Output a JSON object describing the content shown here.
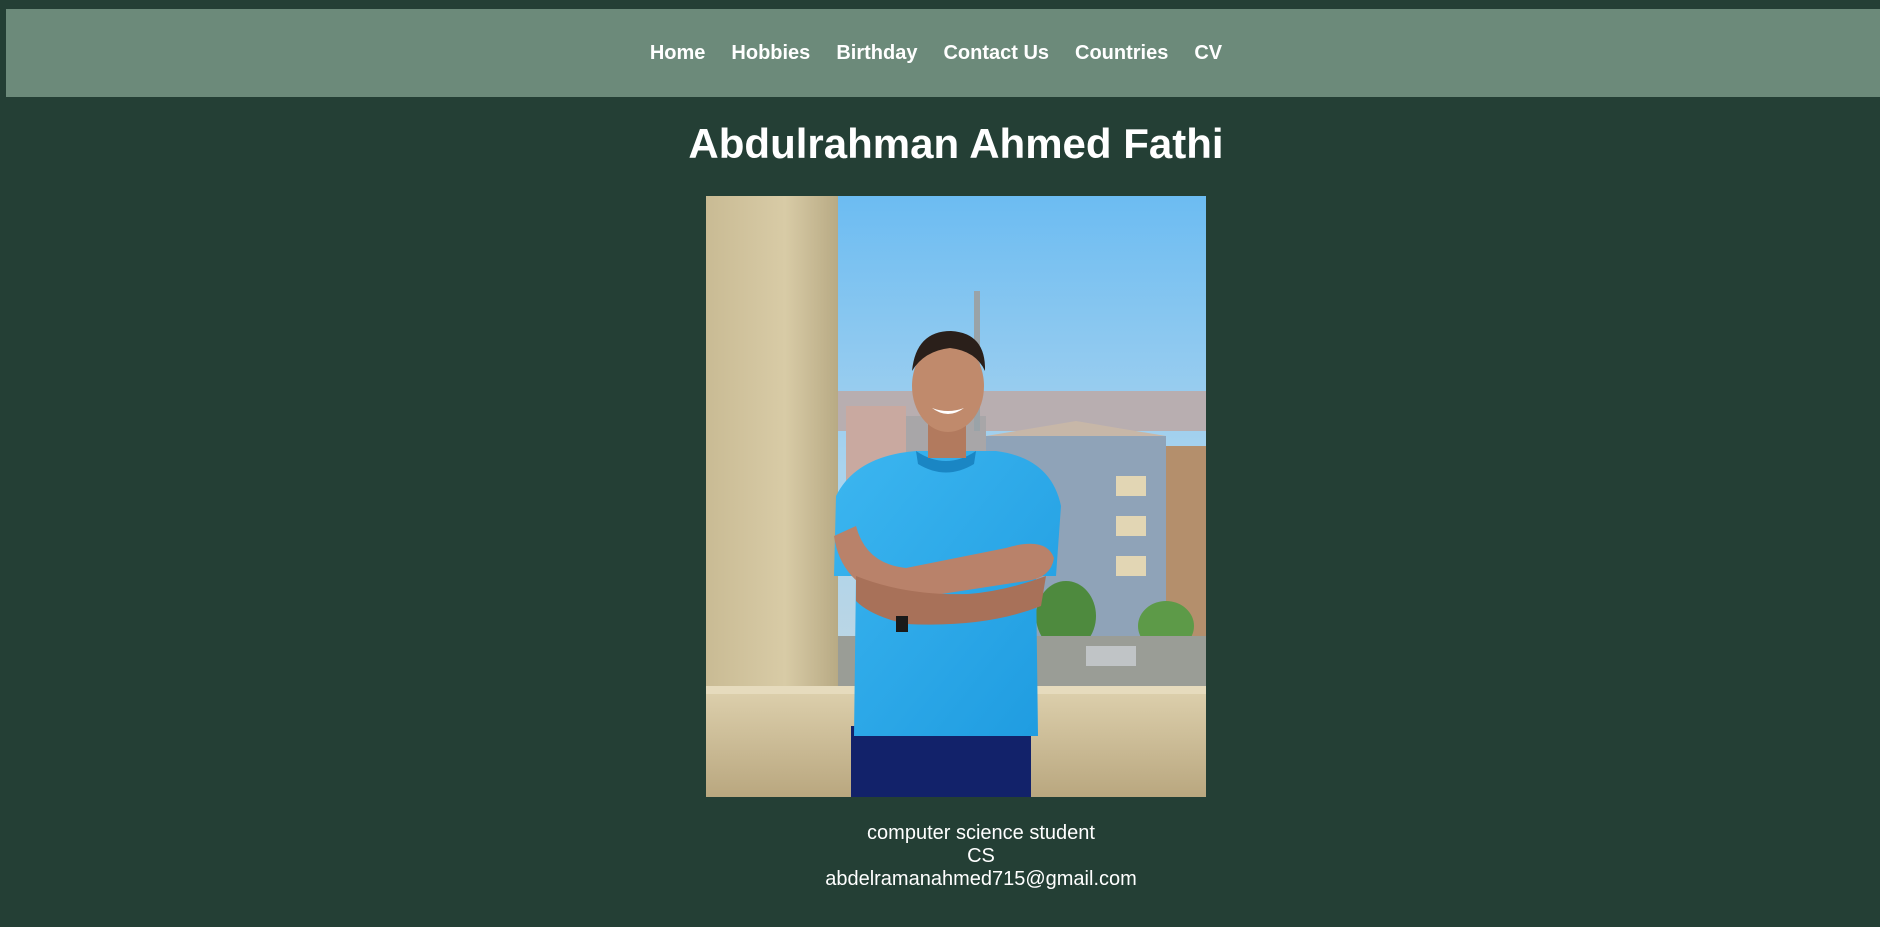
{
  "nav": {
    "items": [
      {
        "label": "Home"
      },
      {
        "label": "Hobbies"
      },
      {
        "label": "Birthday"
      },
      {
        "label": "Contact Us"
      },
      {
        "label": "Countries"
      },
      {
        "label": "CV"
      }
    ]
  },
  "page": {
    "title": "Abdulrahman Ahmed Fathi"
  },
  "profile": {
    "photo_alt": "portrait-photo",
    "description": "computer science student",
    "field": "CS",
    "email": "abdelramanahmed715@gmail.com"
  },
  "colors": {
    "background": "#243f35",
    "navbar": "#6c8a7a",
    "text": "#ffffff"
  }
}
